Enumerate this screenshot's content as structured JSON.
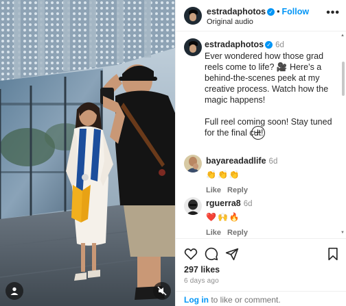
{
  "post": {
    "username": "estradaphotos",
    "follow_label": "Follow",
    "audio": "Original audio",
    "more_label": "•••"
  },
  "caption": {
    "username": "estradaphotos",
    "time": "6d",
    "text": "Ever wondered how those grad reels come to life? 🎥  Here’s a behind-the-scenes peek at my creative process. Watch how the magic happens!",
    "text2": "Full reel coming soon! Stay tuned for the final cut!"
  },
  "comments": [
    {
      "username": "bayareadadlife",
      "time": "6d",
      "emojis": "👏👏👏",
      "like_label": "Like",
      "reply_label": "Reply"
    },
    {
      "username": "rguerra8",
      "time": "6d",
      "emojis": "❤️🙌🔥",
      "like_label": "Like",
      "reply_label": "Reply"
    }
  ],
  "stats": {
    "likes": "297 likes",
    "ago": "6 days ago"
  },
  "login": {
    "login_label": "Log in",
    "rest": " to like or comment."
  },
  "icons": {
    "like": "heart-icon",
    "comment": "comment-icon",
    "share": "share-icon",
    "save": "bookmark-icon",
    "people": "people-tag-icon",
    "mute": "mute-icon",
    "add": "add-comment-icon",
    "more": "more-options-icon"
  },
  "colors": {
    "accent": "#0095f6",
    "text": "#262626",
    "muted": "#8e8e8e",
    "gown": "#f5f1ea",
    "stole": "#1c4e9c",
    "sash": "#f2b01e"
  }
}
